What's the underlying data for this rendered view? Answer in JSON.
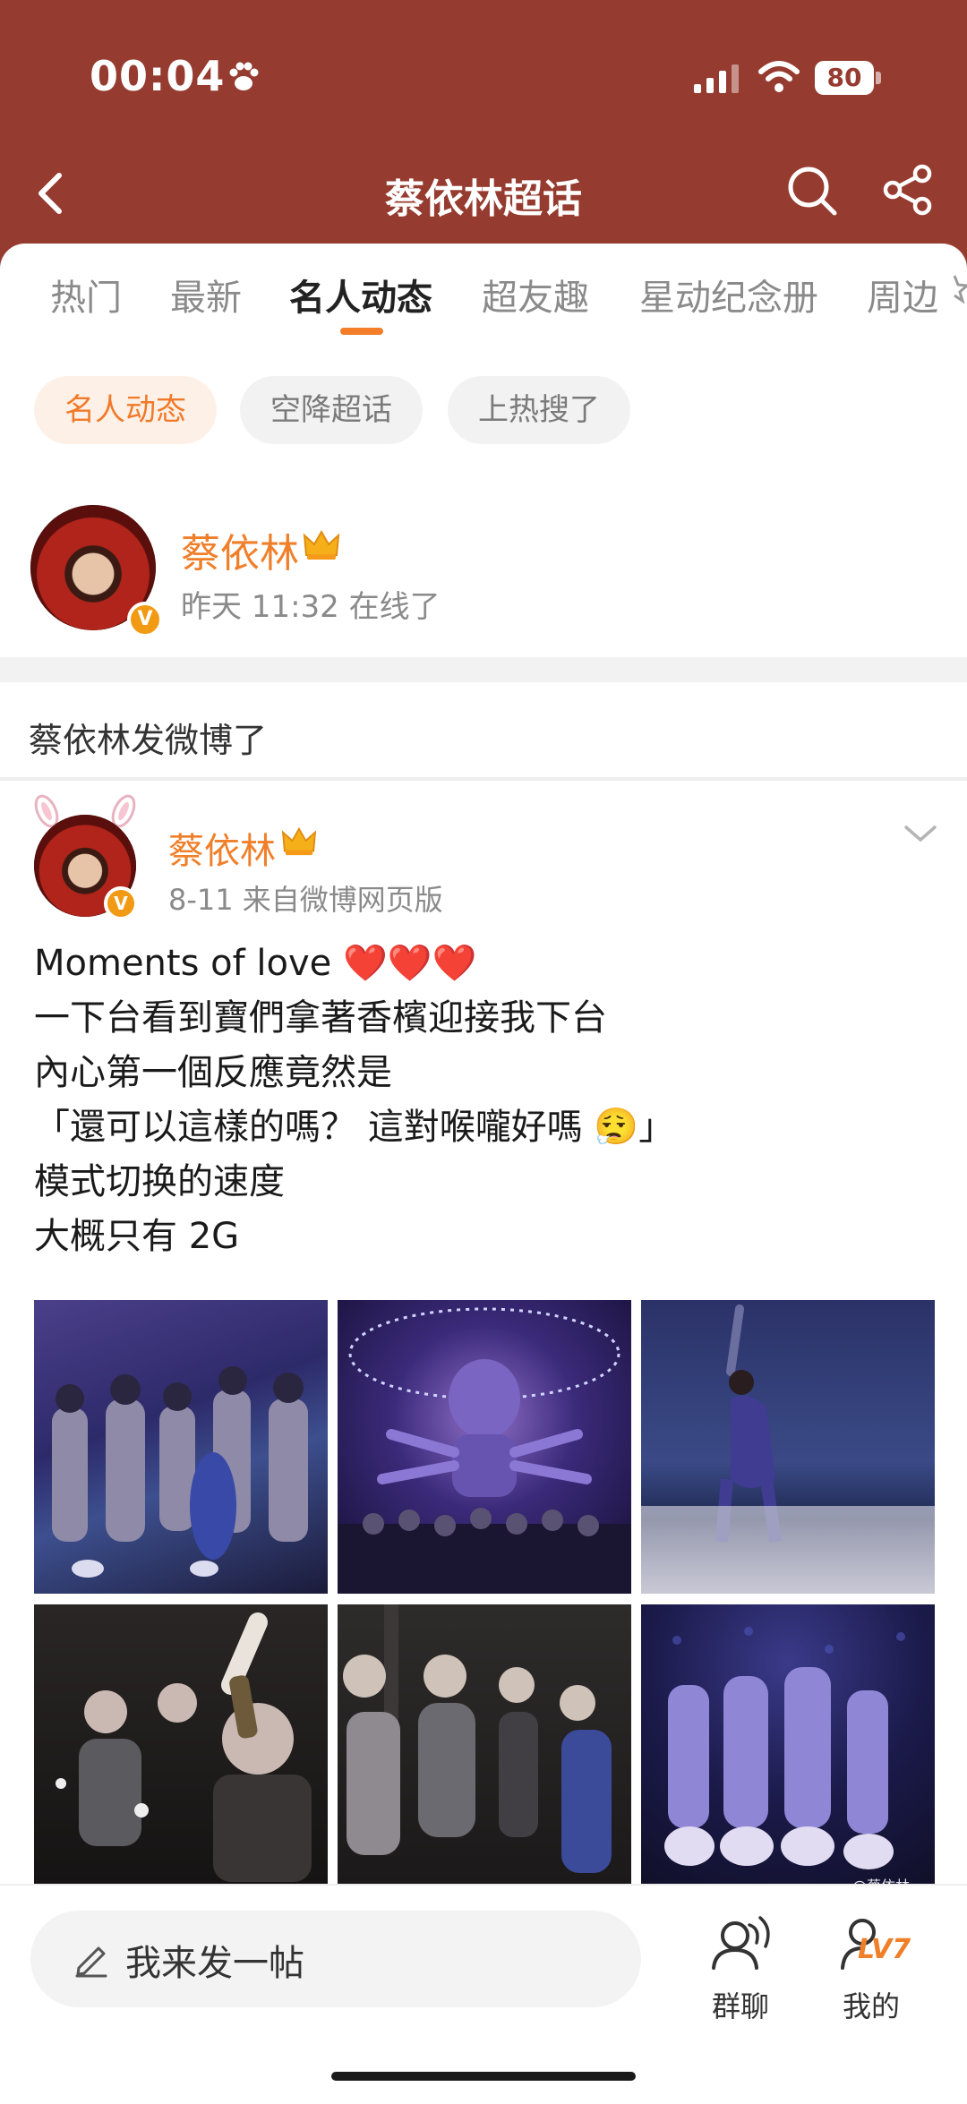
{
  "status_bar": {
    "time": "00:04",
    "battery": "80"
  },
  "nav": {
    "title": "蔡依林超话"
  },
  "tabs": [
    {
      "label": "热门"
    },
    {
      "label": "最新"
    },
    {
      "label": "名人动态"
    },
    {
      "label": "超友趣"
    },
    {
      "label": "星动纪念册"
    },
    {
      "label": "周边"
    }
  ],
  "filters": [
    {
      "label": "名人动态"
    },
    {
      "label": "空降超话"
    },
    {
      "label": "上热搜了"
    }
  ],
  "celebrity": {
    "name": "蔡依林",
    "online": "昨天 11:32 在线了",
    "verified_badge": "V"
  },
  "section_label": "蔡依林发微博了",
  "post": {
    "author": "蔡依林",
    "verified_badge": "V",
    "meta": "8-11  来自微博网页版",
    "lines": [
      "Moments of love ❤️❤️❤️",
      "一下台看到寶們拿著香檳迎接我下台",
      "內心第一個反應竟然是",
      "「還可以這樣的嗎？  這對喉嚨好嗎 😮‍💨」",
      "模式切换的速度",
      "大概只有 2G"
    ],
    "watermark": "@蔡依林"
  },
  "bottom_bar": {
    "compose_placeholder": "我来发一帖",
    "group_chat": "群聊",
    "mine": "我的",
    "level": "LV7"
  },
  "colors": {
    "header": "#963b2f",
    "accent": "#f07f2a"
  }
}
